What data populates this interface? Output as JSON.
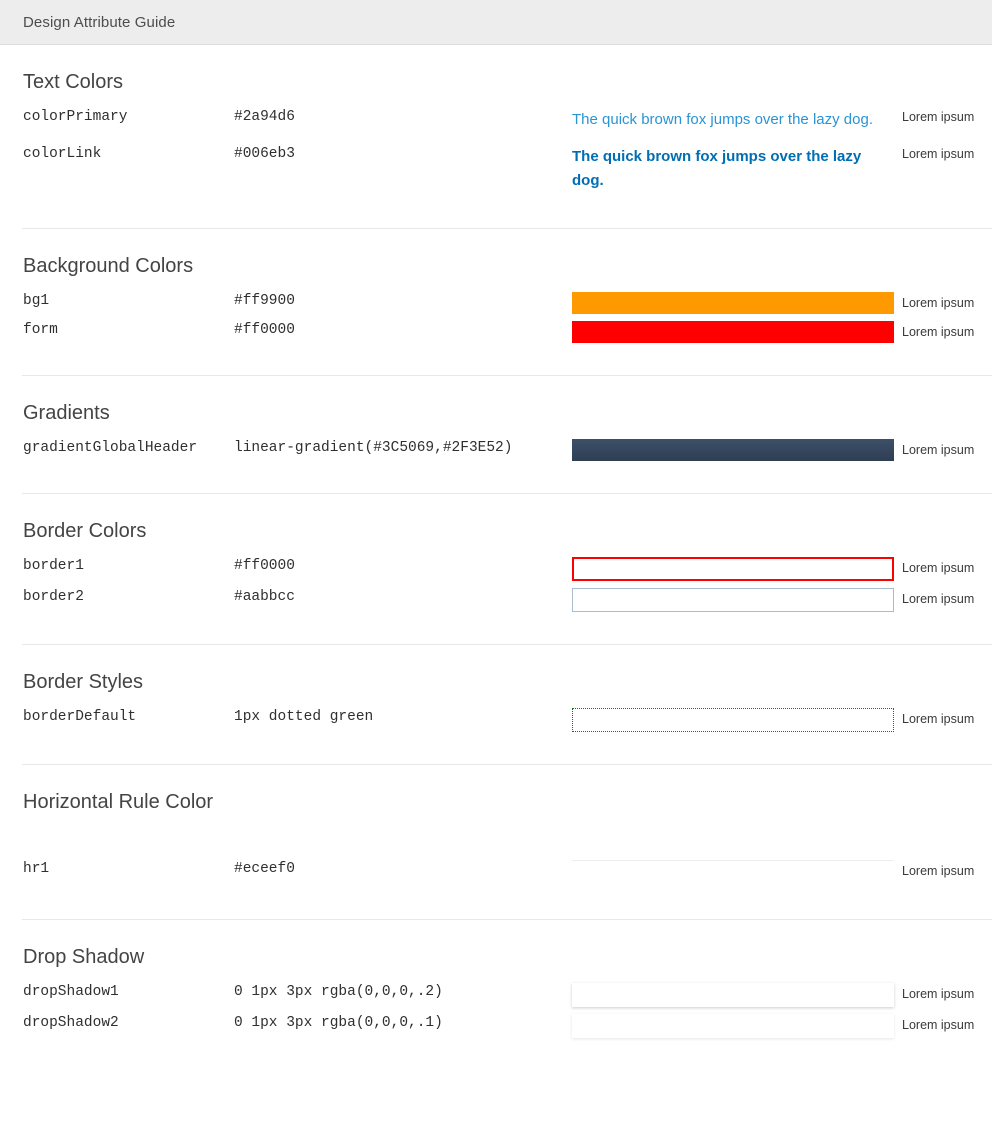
{
  "header": {
    "title": "Design Attribute Guide",
    "background": "#ededed"
  },
  "captions": {
    "lorem": "Lorem ipsum"
  },
  "sections": [
    {
      "id": "text-colors",
      "title": "Text Colors",
      "rows": [
        {
          "name": "colorPrimary",
          "value": "#2a94d6",
          "sample": "The quick brown fox jumps over the lazy dog.",
          "caption": "Lorem ipsum",
          "color": "#2a94d6",
          "weight": "normal"
        },
        {
          "name": "colorLink",
          "value": "#006eb3",
          "sample": "The quick brown fox jumps over the lazy dog.",
          "caption": "Lorem ipsum",
          "color": "#006eb3",
          "weight": "bold"
        }
      ]
    },
    {
      "id": "background-colors",
      "title": "Background Colors",
      "rows": [
        {
          "name": "bg1",
          "value": "#ff9900",
          "caption": "Lorem ipsum",
          "color": "#ff9900"
        },
        {
          "name": "form",
          "value": "#ff0000",
          "caption": "Lorem ipsum",
          "color": "#ff0000"
        }
      ]
    },
    {
      "id": "gradients",
      "title": "Gradients",
      "rows": [
        {
          "name": "gradientGlobalHeader",
          "value": "linear-gradient(#3C5069,#2F3E52)",
          "caption": "Lorem ipsum",
          "gradient_from": "#3C5069",
          "gradient_to": "#2F3E52"
        }
      ]
    },
    {
      "id": "border-colors",
      "title": "Border Colors",
      "rows": [
        {
          "name": "border1",
          "value": "#ff0000",
          "caption": "Lorem ipsum",
          "color": "#ff0000"
        },
        {
          "name": "border2",
          "value": "#aabbcc",
          "caption": "Lorem ipsum",
          "color": "#aabbcc"
        }
      ]
    },
    {
      "id": "border-styles",
      "title": "Border Styles",
      "rows": [
        {
          "name": "borderDefault",
          "value": "1px dotted green",
          "caption": "Lorem ipsum",
          "color": "green"
        }
      ]
    },
    {
      "id": "horizontal-rule-color",
      "title": "Horizontal Rule Color",
      "rows": [
        {
          "name": "hr1",
          "value": "#eceef0",
          "caption": "Lorem ipsum",
          "color": "#eceef0"
        }
      ]
    },
    {
      "id": "drop-shadow",
      "title": "Drop Shadow",
      "rows": [
        {
          "name": "dropShadow1",
          "value": "0 1px 3px rgba(0,0,0,.2)",
          "caption": "Lorem ipsum",
          "shadow": "0 1px 3px rgba(0,0,0,.2)"
        },
        {
          "name": "dropShadow2",
          "value": "0 1px 3px rgba(0,0,0,.1)",
          "caption": "Lorem ipsum",
          "shadow": "0 1px 3px rgba(0,0,0,.1)"
        }
      ]
    }
  ]
}
